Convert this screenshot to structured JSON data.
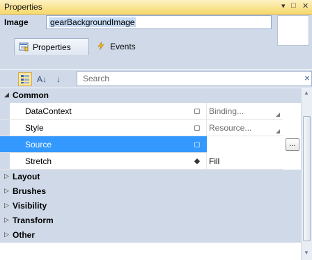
{
  "window": {
    "title": "Properties",
    "dropdown_glyph": "▾",
    "maximize_glyph": "□",
    "close_glyph": "✕"
  },
  "header": {
    "name_label": "Image",
    "name_value": "gearBackgroundImage"
  },
  "tabs": [
    {
      "label": "Properties",
      "icon": "properties-icon",
      "active": true
    },
    {
      "label": "Events",
      "icon": "lightning-icon",
      "active": false
    }
  ],
  "toolbar": {
    "categorized_icon": "categorized-view-icon",
    "sort_az_glyph": "A↓",
    "sort_source_glyph": "↓",
    "search_placeholder": "Search",
    "clear_glyph": "×"
  },
  "categories": [
    {
      "name": "Common",
      "expanded": true,
      "properties": [
        {
          "name": "DataContext",
          "marker": "◻",
          "value": "Binding...",
          "value_muted": true,
          "selected": false
        },
        {
          "name": "Style",
          "marker": "◻",
          "value": "Resource...",
          "value_muted": true,
          "selected": false
        },
        {
          "name": "Source",
          "marker": "◻",
          "value": "",
          "value_muted": false,
          "selected": true,
          "ellipsis": "..."
        },
        {
          "name": "Stretch",
          "marker": "◆",
          "value": "Fill",
          "value_muted": false,
          "selected": false
        }
      ]
    },
    {
      "name": "Layout",
      "expanded": false
    },
    {
      "name": "Brushes",
      "expanded": false
    },
    {
      "name": "Visibility",
      "expanded": false
    },
    {
      "name": "Transform",
      "expanded": false
    },
    {
      "name": "Other",
      "expanded": false
    }
  ],
  "colors": {
    "accent_selection": "#3399ff",
    "panel_background": "#cfd9e8",
    "title_gradient_top": "#fdf2c4",
    "title_gradient_bottom": "#f6d86a"
  }
}
